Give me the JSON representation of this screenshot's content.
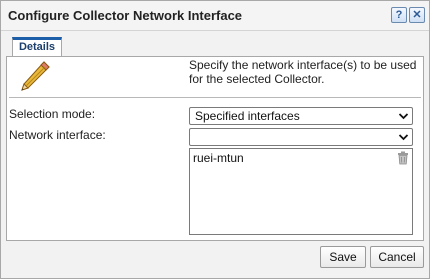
{
  "window": {
    "title": "Configure Collector Network Interface",
    "help_label": "?",
    "close_label": "✕"
  },
  "tabs": [
    {
      "label": "Details",
      "active": true
    }
  ],
  "panel": {
    "intro": "Specify the network interface(s) to be used for the selected Collector.",
    "icon": "pencil-icon",
    "selection_mode": {
      "label": "Selection mode:",
      "value": "Specified interfaces"
    },
    "network_interface": {
      "label": "Network interface:",
      "value": ""
    },
    "interfaces": [
      {
        "name": "ruei-mtun",
        "action_icon": "trash-icon"
      }
    ]
  },
  "footer": {
    "save_label": "Save",
    "cancel_label": "Cancel"
  },
  "colors": {
    "accent": "#1c5fa8",
    "dialog_bg": "#f2f2f2",
    "panel_bg": "#ffffff"
  }
}
